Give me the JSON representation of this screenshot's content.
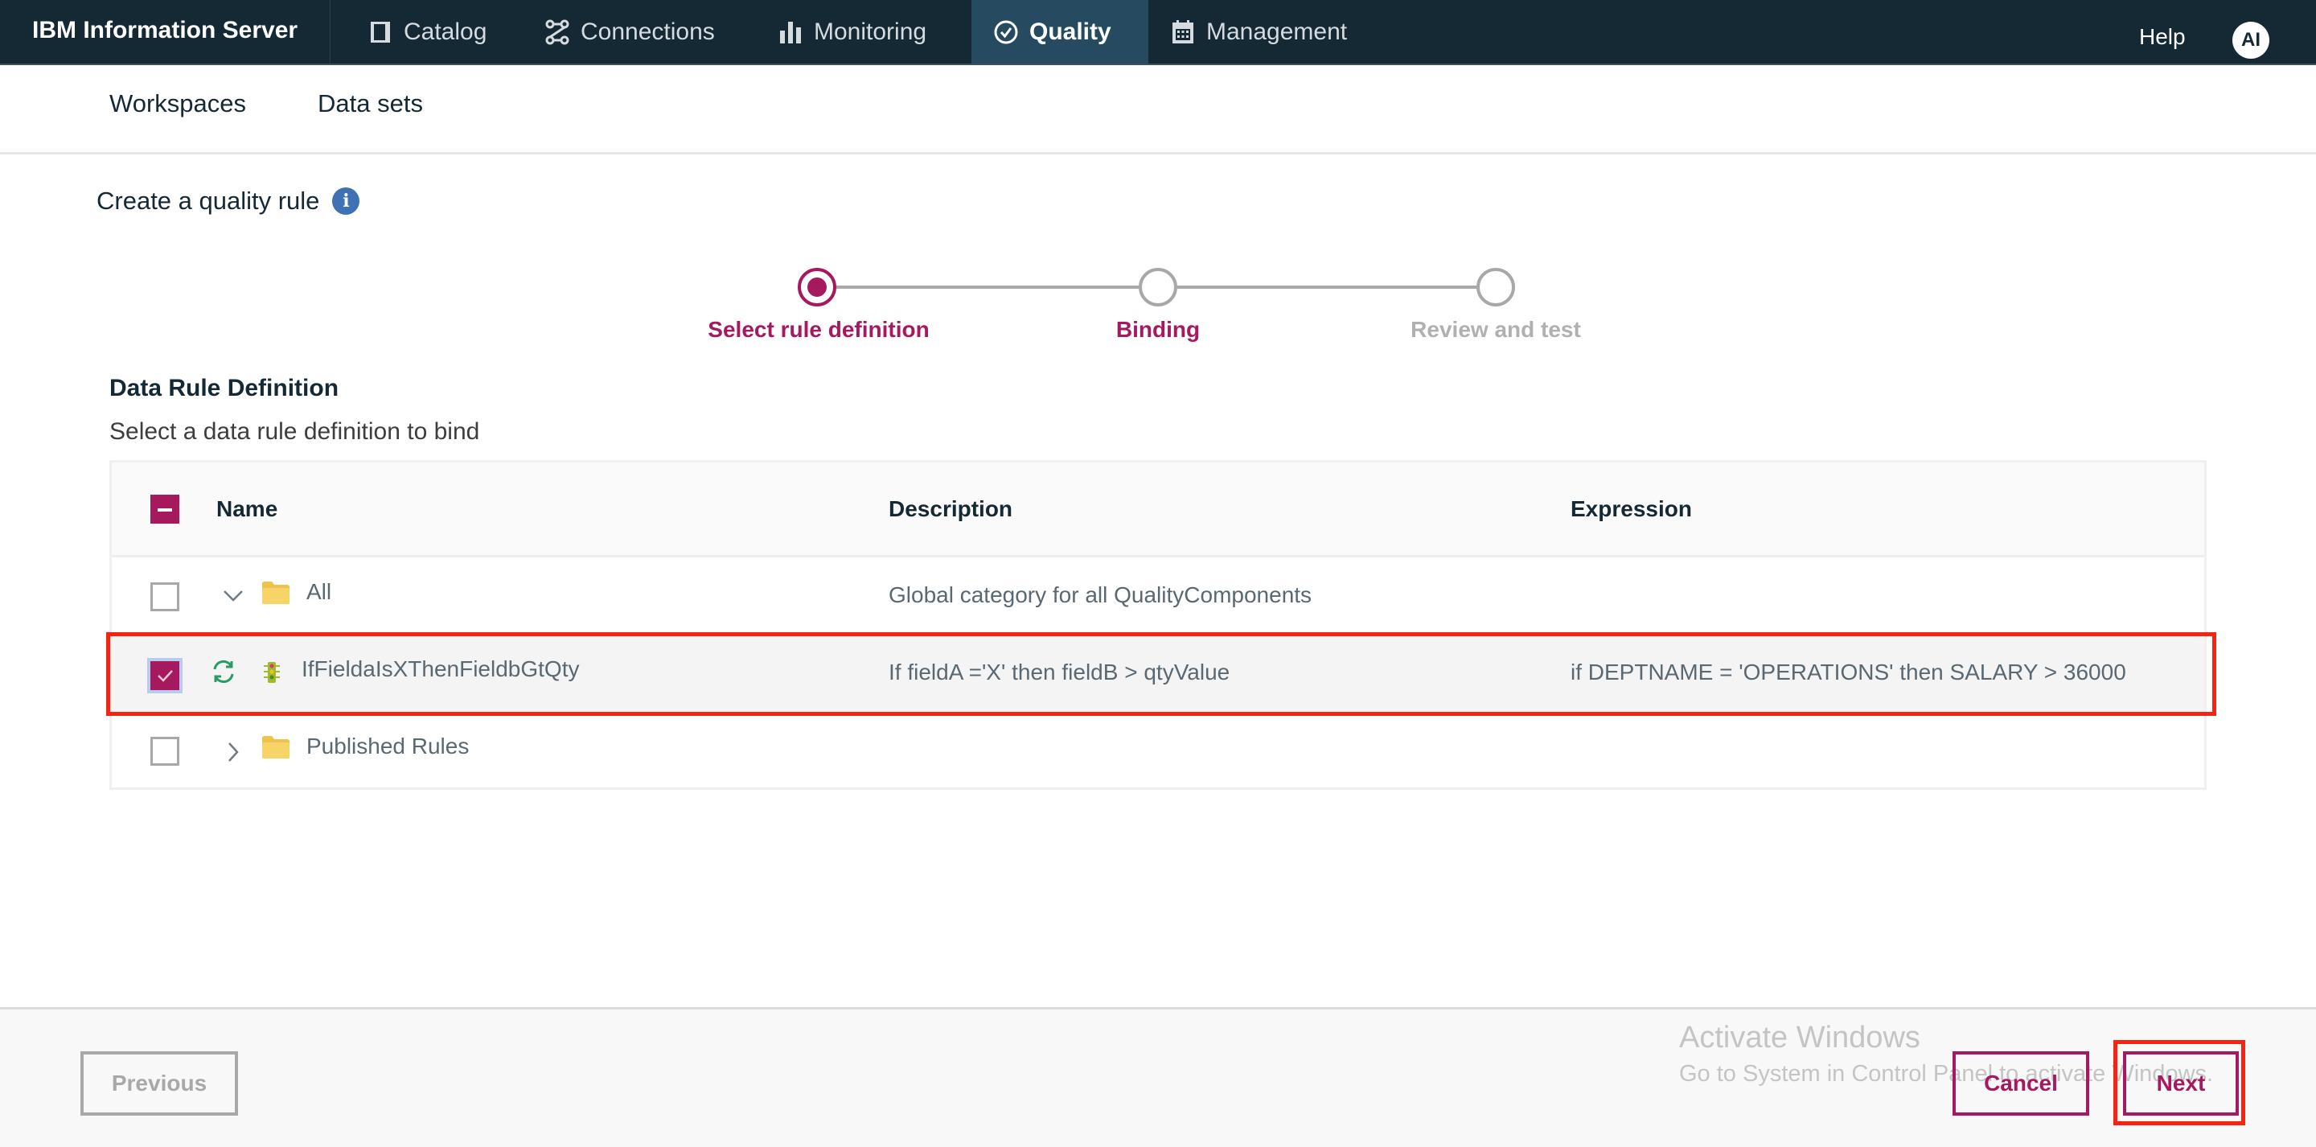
{
  "topbar": {
    "brand": "IBM Information Server",
    "nav": [
      {
        "label": "Catalog",
        "icon": "book-icon"
      },
      {
        "label": "Connections",
        "icon": "connections-icon"
      },
      {
        "label": "Monitoring",
        "icon": "bar-chart-icon"
      },
      {
        "label": "Quality",
        "icon": "check-circle-icon",
        "active": true
      },
      {
        "label": "Management",
        "icon": "calendar-icon"
      }
    ],
    "help": "Help",
    "avatar": "AI"
  },
  "subnav": {
    "items": [
      "Workspaces",
      "Data sets"
    ]
  },
  "page": {
    "title": "Create a quality rule",
    "info_icon": "i"
  },
  "stepper": {
    "steps": [
      {
        "label": "Select rule definition",
        "state": "current"
      },
      {
        "label": "Binding",
        "state": "upcoming-enabled"
      },
      {
        "label": "Review and test",
        "state": "upcoming-disabled"
      }
    ]
  },
  "section": {
    "title": "Data Rule Definition",
    "subtitle": "Select a data rule definition to bind"
  },
  "table": {
    "columns": [
      "Name",
      "Description",
      "Expression"
    ],
    "rows": [
      {
        "name": "All",
        "type": "folder",
        "expanded": true,
        "checked": false,
        "description": "Global category for all QualityComponents",
        "expression": ""
      },
      {
        "name": "IfFieldaIsXThenFieldbGtQty",
        "type": "rule",
        "checked": true,
        "description": "If fieldA ='X' then fieldB > qtyValue",
        "expression": "if DEPTNAME = 'OPERATIONS' then SALARY > 36000"
      },
      {
        "name": "Published Rules",
        "type": "folder",
        "expanded": false,
        "checked": false,
        "description": "",
        "expression": ""
      }
    ]
  },
  "footer": {
    "previous": "Previous",
    "cancel": "Cancel",
    "next": "Next",
    "watermark_title": "Activate Windows",
    "watermark_sub": "Go to System in Control Panel to activate Windows."
  },
  "colors": {
    "accent": "#a6195e",
    "topbar": "#152935",
    "active_nav": "#264a60",
    "highlight": "#f5230f"
  }
}
